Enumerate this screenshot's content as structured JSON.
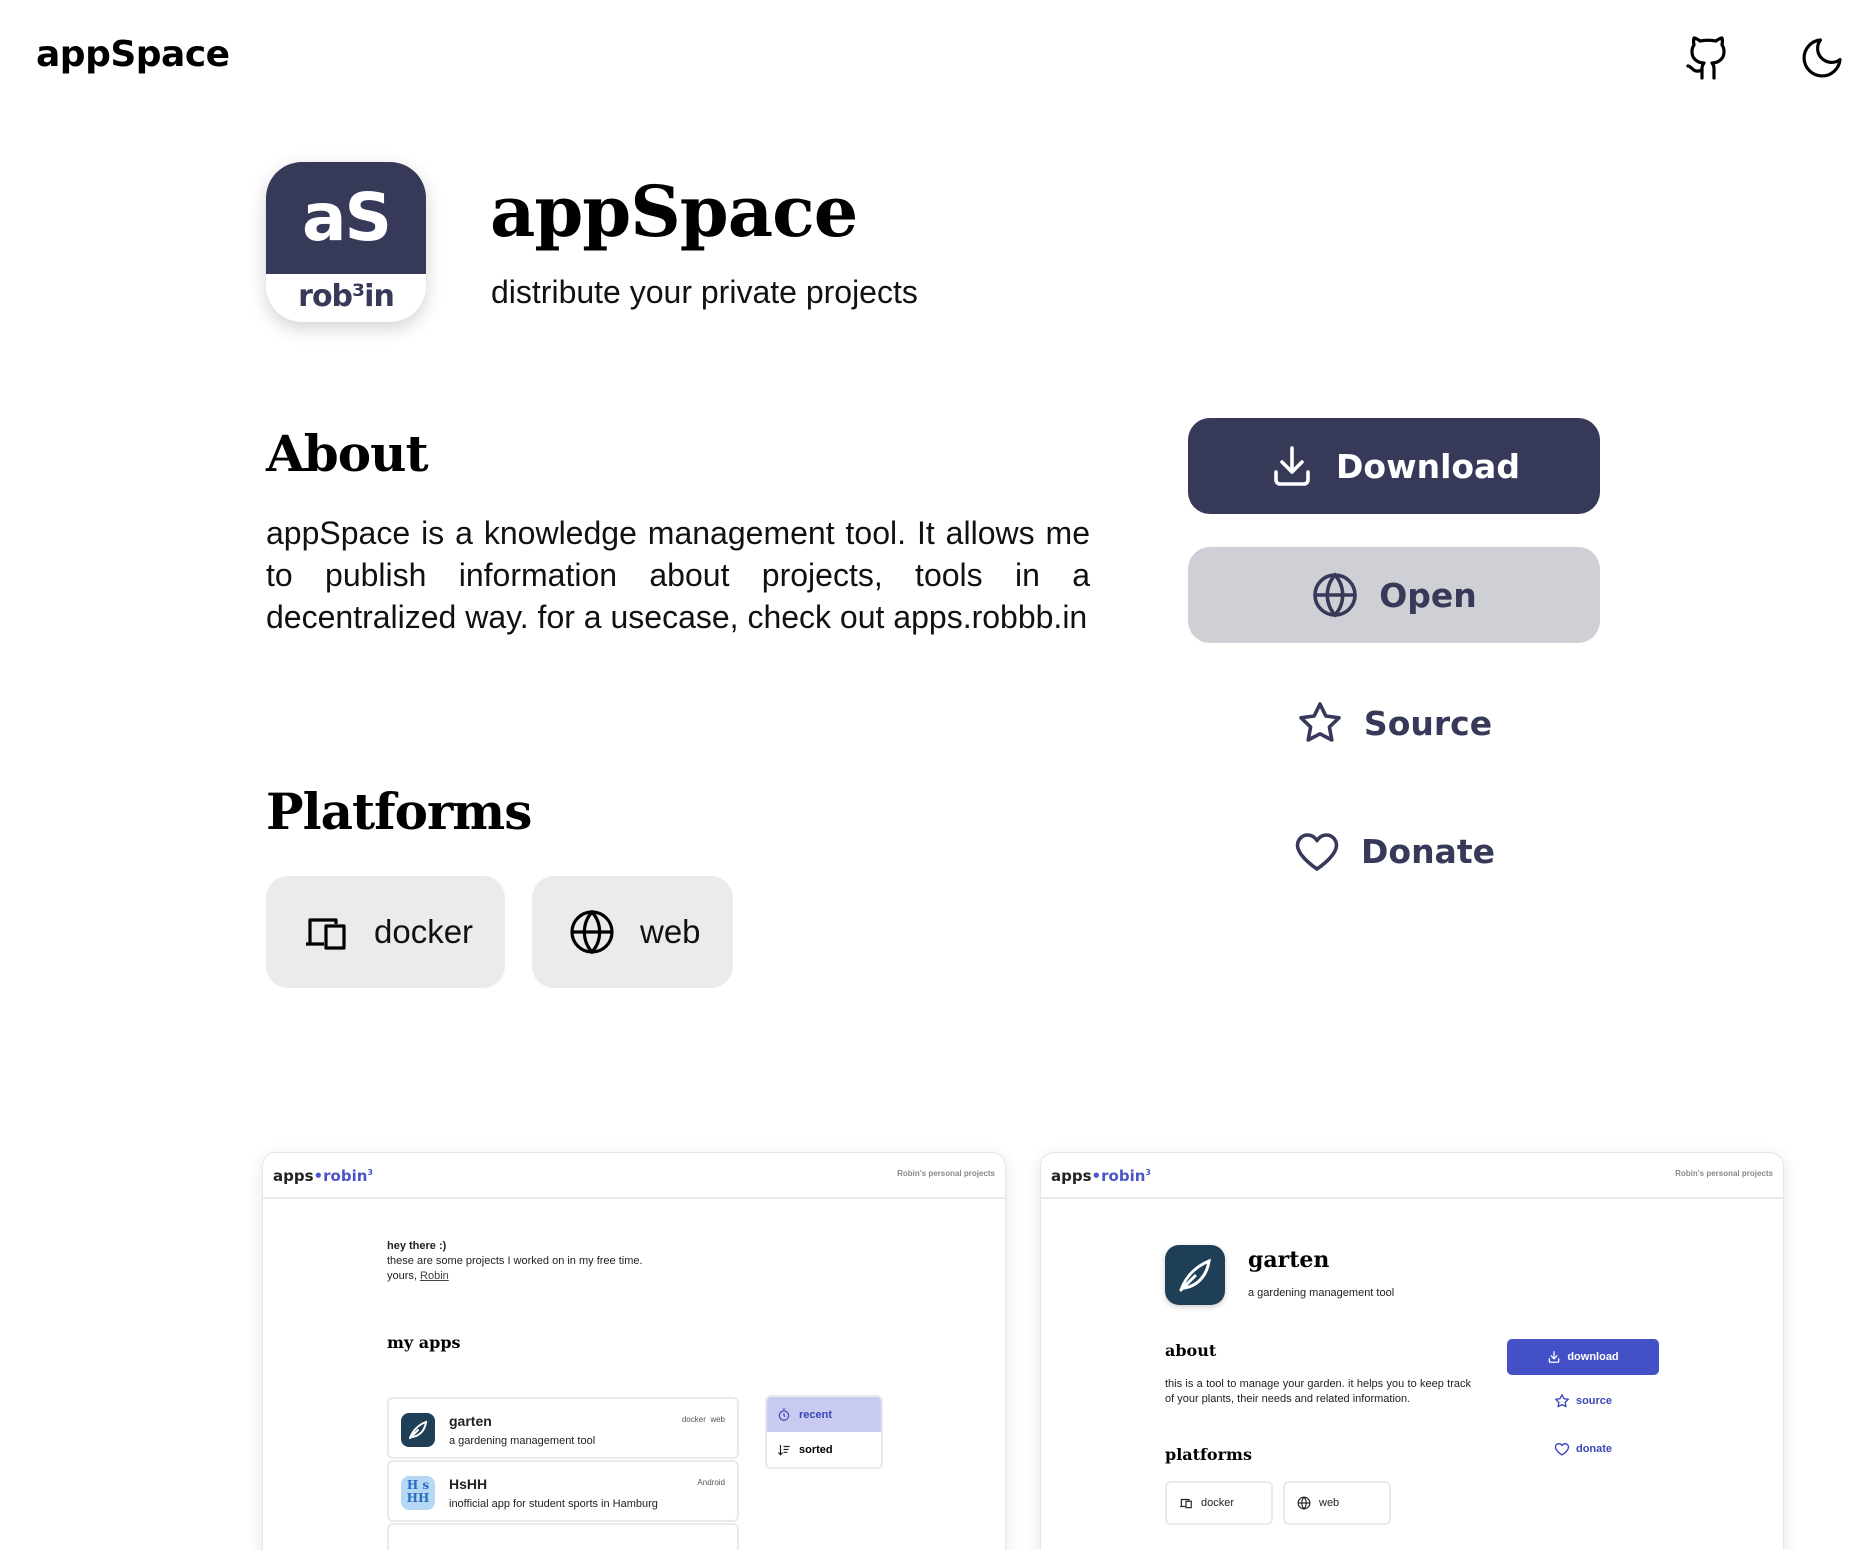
{
  "header": {
    "brand": "appSpace",
    "github_icon": "github-icon",
    "theme_icon": "moon-icon"
  },
  "app": {
    "logo_top": "aS",
    "logo_bottom": "rob³in",
    "title": "appSpace",
    "tagline": "distribute your private projects"
  },
  "about": {
    "heading": "About",
    "text": "appSpace is a knowledge management tool. It allows me to publish information about projects, tools in a decentralized way. for a usecase, check out apps.robbb.in"
  },
  "platforms": {
    "heading": "Platforms",
    "items": [
      {
        "label": "docker",
        "icon": "devices-icon"
      },
      {
        "label": "web",
        "icon": "globe-icon"
      }
    ]
  },
  "actions": {
    "download": "Download",
    "open": "Open",
    "source": "Source",
    "donate": "Donate"
  },
  "colors": {
    "primary": "#363a58",
    "secondary": "#cfd0d5",
    "chip": "#ebebed",
    "accent": "#4450c6"
  },
  "screenshots": [
    {
      "logo_prefix": "apps",
      "logo_dot": "•",
      "logo_suffix": "robin",
      "logo_sup": "3",
      "subtitle": "Robin's personal projects",
      "greeting_title": "hey there :)",
      "greeting_line": "these are some projects I worked on in my free time.",
      "greeting_sign": "yours,",
      "greeting_link": "Robin",
      "heading": "my apps",
      "apps": [
        {
          "name": "garten",
          "desc": "a gardening management tool",
          "tags": "docker  web"
        },
        {
          "name": "HsHH",
          "desc": "inofficial app for student sports in Hamburg",
          "tags": "Android"
        }
      ],
      "sort_options": [
        "recent",
        "sorted"
      ]
    },
    {
      "logo_prefix": "apps",
      "logo_dot": "•",
      "logo_suffix": "robin",
      "logo_sup": "3",
      "subtitle": "Robin's personal projects",
      "app_name": "garten",
      "app_tagline": "a gardening management tool",
      "about_heading": "about",
      "about_text": "this is a tool to manage your garden. it helps you to keep track of your plants, their needs and related information.",
      "platforms_heading": "platforms",
      "platforms": [
        "docker",
        "web"
      ],
      "download": "download",
      "source": "source",
      "donate": "donate"
    }
  ]
}
